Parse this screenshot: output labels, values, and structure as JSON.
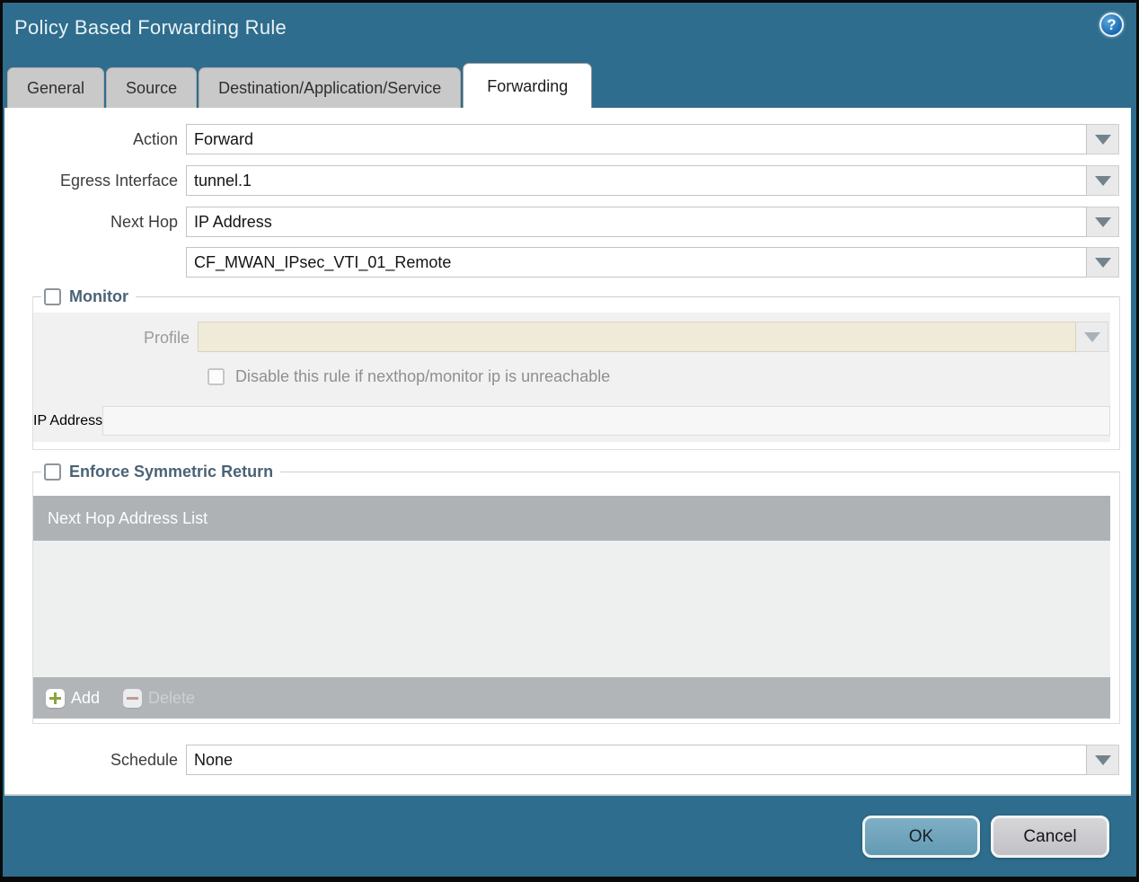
{
  "dialog": {
    "title": "Policy Based Forwarding Rule"
  },
  "icons": {
    "help": "?"
  },
  "tabs": [
    {
      "label": "General",
      "active": false
    },
    {
      "label": "Source",
      "active": false
    },
    {
      "label": "Destination/Application/Service",
      "active": false
    },
    {
      "label": "Forwarding",
      "active": true
    }
  ],
  "form": {
    "action_label": "Action",
    "action_value": "Forward",
    "egress_label": "Egress Interface",
    "egress_value": "tunnel.1",
    "next_hop_label": "Next Hop",
    "next_hop_value": "IP Address",
    "next_hop_address_value": "CF_MWAN_IPsec_VTI_01_Remote",
    "schedule_label": "Schedule",
    "schedule_value": "None"
  },
  "monitor": {
    "legend": "Monitor",
    "checked": false,
    "profile_label": "Profile",
    "profile_value": "",
    "disable_label": "Disable this rule if nexthop/monitor ip is unreachable",
    "disable_checked": false,
    "ip_label": "IP Address",
    "ip_value": ""
  },
  "symmetric_return": {
    "legend": "Enforce Symmetric Return",
    "checked": false,
    "list_header": "Next Hop Address List",
    "rows": [],
    "add_label": "Add",
    "delete_label": "Delete",
    "delete_enabled": false
  },
  "footer": {
    "ok_label": "OK",
    "cancel_label": "Cancel"
  },
  "colors": {
    "titlebar_teal": "#2e6d8d",
    "active_tab": "#ffffff",
    "inactive_tab": "#c9c9c9",
    "disabled_field_cream": "#f0ebd9",
    "table_header_gray": "#aeb2b5",
    "add_plus_green": "#8ba442",
    "delete_minus_red": "#c4908e",
    "ok_button_blue": "#6ea6be"
  }
}
